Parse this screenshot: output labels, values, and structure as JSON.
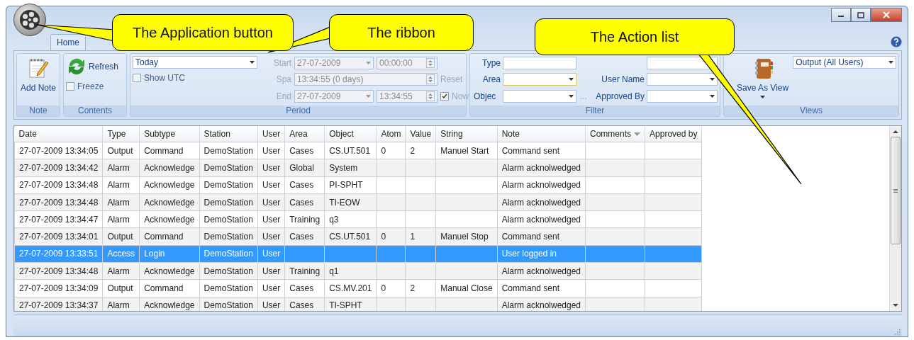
{
  "callouts": [
    {
      "text": "The Application button"
    },
    {
      "text": "The ribbon"
    },
    {
      "text": "The Action list"
    }
  ],
  "ribbon": {
    "tabs": [
      {
        "label": "Home",
        "selected": true
      }
    ],
    "note": {
      "label": "Note",
      "add_note": "Add Note"
    },
    "contents": {
      "label": "Contents",
      "refresh": "Refresh",
      "freeze": {
        "label": "Freeze",
        "checked": false
      }
    },
    "period": {
      "label": "Period",
      "preset": "Today",
      "show_utc": {
        "label": "Show UTC",
        "checked": false
      },
      "start": {
        "label": "Start",
        "date": "27-07-2009",
        "time": "00:00:00"
      },
      "span": {
        "label": "Spa",
        "value": "13:34:55 (0 days)",
        "reset": "Reset"
      },
      "end": {
        "label": "End",
        "date": "27-07-2009",
        "time": "13:34:55"
      },
      "now": {
        "label": "Now",
        "checked": true
      }
    },
    "filter": {
      "label": "Filter",
      "type": "Type",
      "area": "Area",
      "object": "Objec",
      "browse": "...",
      "user_name": "User Name",
      "approved_by": "Approved By"
    },
    "views": {
      "label": "Views",
      "save_as_view": "Save As View",
      "view": "Output (All Users)"
    }
  },
  "table": {
    "columns": [
      {
        "label": "Date",
        "has_filter": false
      },
      {
        "label": "Type",
        "has_filter": false
      },
      {
        "label": "Subtype",
        "has_filter": false
      },
      {
        "label": "Station",
        "has_filter": false
      },
      {
        "label": "User",
        "has_filter": false
      },
      {
        "label": "Area",
        "has_filter": false
      },
      {
        "label": "Object",
        "has_filter": false
      },
      {
        "label": "Atom",
        "has_filter": false
      },
      {
        "label": "Value",
        "has_filter": false
      },
      {
        "label": "String",
        "has_filter": false
      },
      {
        "label": "Note",
        "has_filter": false
      },
      {
        "label": "Comments",
        "has_filter": true
      },
      {
        "label": "Approved by",
        "has_filter": false
      }
    ],
    "rows": [
      {
        "selected": false,
        "cells": [
          "27-07-2009 13:34:05",
          "Output",
          "Command",
          "DemoStation",
          "User",
          "Cases",
          "CS.UT.501",
          "0",
          "2",
          "Manuel Start",
          "Command sent",
          "",
          ""
        ]
      },
      {
        "selected": false,
        "cells": [
          "27-07-2009 13:34:42",
          "Alarm",
          "Acknowledge",
          "DemoStation",
          "User",
          "Global",
          "System",
          "",
          "",
          "",
          "Alarm acknolwedged",
          "",
          ""
        ]
      },
      {
        "selected": false,
        "cells": [
          "27-07-2009 13:34:48",
          "Alarm",
          "Acknowledge",
          "DemoStation",
          "User",
          "Cases",
          "PI-SPHT",
          "",
          "",
          "",
          "Alarm acknolwedged",
          "",
          ""
        ]
      },
      {
        "selected": false,
        "cells": [
          "27-07-2009 13:34:48",
          "Alarm",
          "Acknowledge",
          "DemoStation",
          "User",
          "Cases",
          "TI-EOW",
          "",
          "",
          "",
          "Alarm acknolwedged",
          "",
          ""
        ]
      },
      {
        "selected": false,
        "cells": [
          "27-07-2009 13:34:47",
          "Alarm",
          "Acknowledge",
          "DemoStation",
          "User",
          "Training",
          "q3",
          "",
          "",
          "",
          "Alarm acknolwedged",
          "",
          ""
        ]
      },
      {
        "selected": false,
        "cells": [
          "27-07-2009 13:34:01",
          "Output",
          "Command",
          "DemoStation",
          "User",
          "Cases",
          "CS.UT.501",
          "0",
          "1",
          "Manuel Stop",
          "Command sent",
          "",
          ""
        ]
      },
      {
        "selected": true,
        "cells": [
          "27-07-2009 13:33:51",
          "Access",
          "Login",
          "DemoStation",
          "User",
          "",
          "",
          "",
          "",
          "",
          "User logged in",
          "",
          ""
        ]
      },
      {
        "selected": false,
        "cells": [
          "27-07-2009 13:34:48",
          "Alarm",
          "Acknowledge",
          "DemoStation",
          "User",
          "Training",
          "q1",
          "",
          "",
          "",
          "Alarm acknolwedged",
          "",
          ""
        ]
      },
      {
        "selected": false,
        "cells": [
          "27-07-2009 13:34:09",
          "Output",
          "Command",
          "DemoStation",
          "User",
          "Cases",
          "CS.MV.201",
          "0",
          "2",
          "Manual Close",
          "Command sent",
          "",
          ""
        ]
      },
      {
        "selected": false,
        "cells": [
          "27-07-2009 13:34:37",
          "Alarm",
          "Acknowledge",
          "DemoStation",
          "User",
          "Cases",
          "TI-SPHT",
          "",
          "",
          "",
          "Alarm acknolwedged",
          "",
          ""
        ]
      }
    ]
  }
}
